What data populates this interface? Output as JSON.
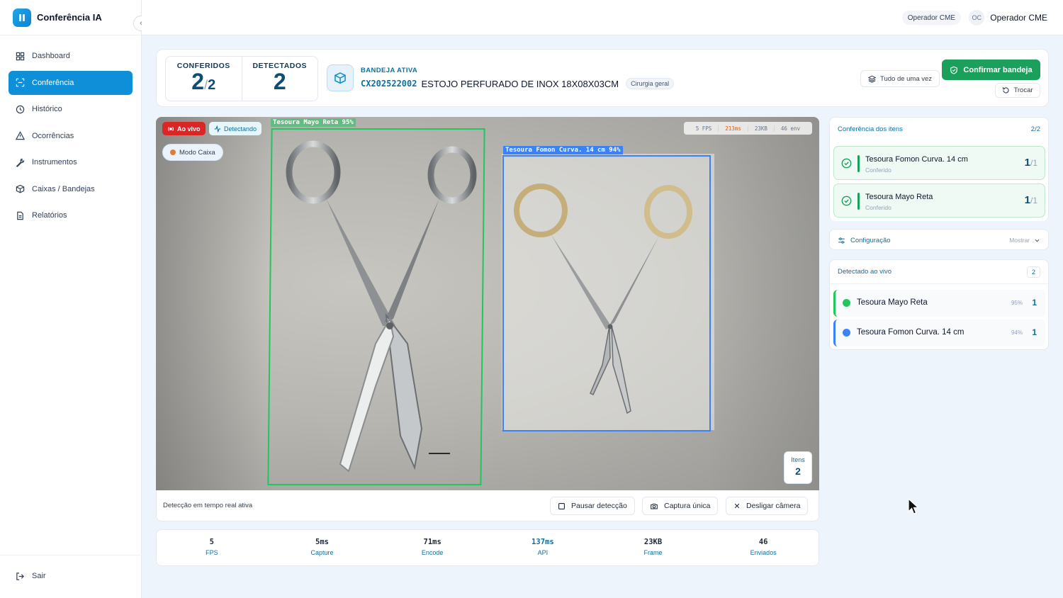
{
  "app": {
    "title": "Conferência IA"
  },
  "sidebar": {
    "items": [
      {
        "label": "Dashboard",
        "icon": "grid-icon"
      },
      {
        "label": "Conferência",
        "icon": "scan-icon",
        "active": true
      },
      {
        "label": "Histórico",
        "icon": "history-icon"
      },
      {
        "label": "Ocorrências",
        "icon": "alert-triangle-icon"
      },
      {
        "label": "Instrumentos",
        "icon": "wrench-icon"
      },
      {
        "label": "Caixas / Bandejas",
        "icon": "box-icon"
      },
      {
        "label": "Relatórios",
        "icon": "document-icon"
      }
    ],
    "logout": "Sair"
  },
  "topbar": {
    "role": "Operador CME",
    "avatar_initials": "OC",
    "user_name": "Operador CME"
  },
  "header": {
    "conferidos_label": "CONFERIDOS",
    "conferidos_value": "2",
    "conferidos_total": "2",
    "detectados_label": "DETECTADOS",
    "detectados_value": "2",
    "tray_label": "BANDEJA ATIVA",
    "tray_code": "CX202522002",
    "tray_name": "ESTOJO PERFURADO DE INOX 18X08X03CM",
    "tray_tag": "Cirurgia geral",
    "all_at_once": "Tudo de uma vez",
    "confirm": "Confirmar bandeja",
    "swap": "Trocar"
  },
  "camera": {
    "live": "Ao vivo",
    "detecting": "Detectando",
    "mode": "Modo Caixa",
    "stats": {
      "fps": "5 FPS",
      "latency": "213ms",
      "size": "23KB",
      "sent": "46 env"
    },
    "detections": [
      {
        "label": "Tesoura Mayo Reta 95%",
        "color": "#22c55e"
      },
      {
        "label": "Tesoura Fomon Curva. 14 cm 94%",
        "color": "#3b82f6"
      }
    ],
    "items_label": "Itens",
    "items_value": "2",
    "status": "Detecção em tempo real ativa",
    "pause": "Pausar detecção",
    "capture": "Captura única",
    "off": "Desligar câmera"
  },
  "metrics": [
    {
      "value": "5",
      "label": "FPS"
    },
    {
      "value": "5ms",
      "label": "Capture"
    },
    {
      "value": "71ms",
      "label": "Encode"
    },
    {
      "value": "137ms",
      "label": "API"
    },
    {
      "value": "23KB",
      "label": "Frame"
    },
    {
      "value": "46",
      "label": "Enviados"
    }
  ],
  "checklist": {
    "title": "Conferência dos itens",
    "count": "2/2",
    "items": [
      {
        "name": "Tesoura Fomon Curva. 14 cm",
        "status": "Conferido",
        "done": "1",
        "total": "1"
      },
      {
        "name": "Tesoura Mayo Reta",
        "status": "Conferido",
        "done": "1",
        "total": "1"
      }
    ]
  },
  "config": {
    "title": "Configuração",
    "toggle": "Mostrar"
  },
  "live_detected": {
    "title": "Detectado ao vivo",
    "count": "2",
    "items": [
      {
        "name": "Tesoura Mayo Reta",
        "pct": "95%",
        "count": "1",
        "color": "#22c55e"
      },
      {
        "name": "Tesoura Fomon Curva. 14 cm",
        "pct": "94%",
        "count": "1",
        "color": "#3b82f6"
      }
    ]
  },
  "colors": {
    "accent": "#0f8fd8",
    "success": "#1aa05a",
    "danger": "#dc2626"
  }
}
